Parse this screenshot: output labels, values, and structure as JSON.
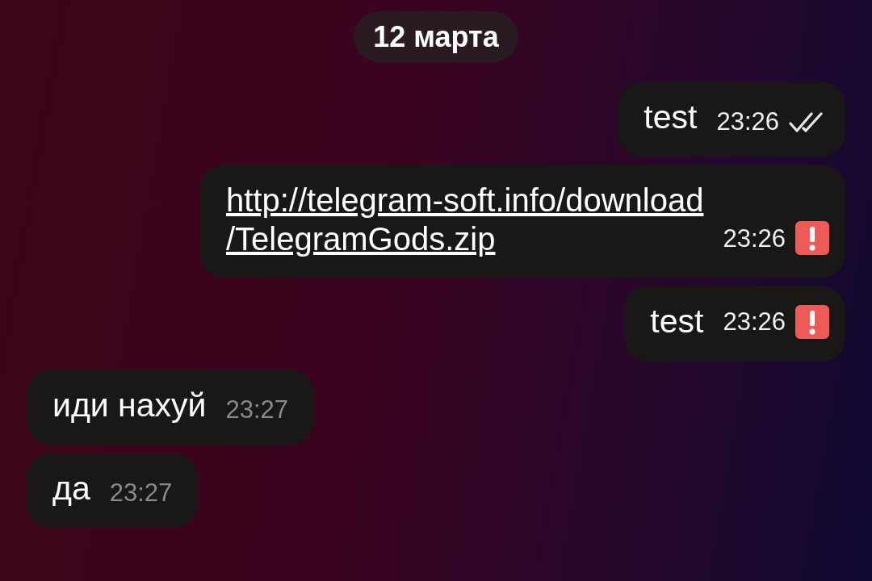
{
  "date_pill": "12 марта",
  "messages": [
    {
      "outgoing": true,
      "kind": "text",
      "text": "test",
      "time": "23:26",
      "read": true,
      "failed": false
    },
    {
      "outgoing": true,
      "kind": "link",
      "lines": [
        "http://telegram-soft.info/download",
        "/TelegramGods.zip"
      ],
      "time": "23:26",
      "failed": true
    },
    {
      "outgoing": true,
      "kind": "text",
      "text": "test",
      "time": "23:26",
      "failed": true
    },
    {
      "outgoing": false,
      "kind": "text",
      "text": "иди нахуй",
      "time": "23:27"
    },
    {
      "outgoing": false,
      "kind": "text",
      "text": "да",
      "time": "23:27"
    }
  ]
}
